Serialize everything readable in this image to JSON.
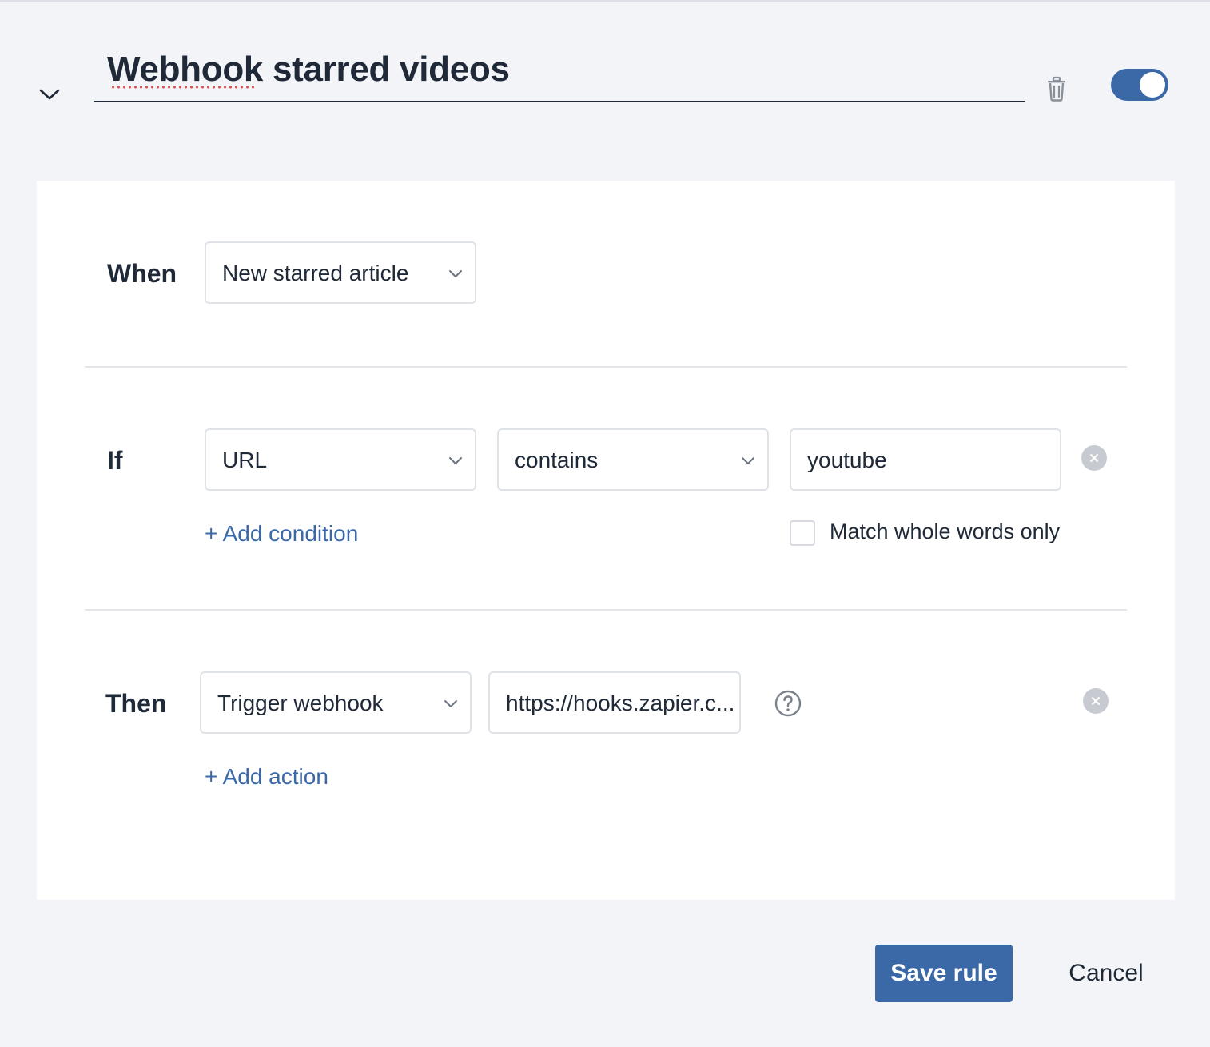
{
  "rule": {
    "title": "Webhook starred videos",
    "enabled": true
  },
  "when": {
    "label": "When",
    "trigger": "New starred article"
  },
  "if": {
    "label": "If",
    "field": "URL",
    "operator": "contains",
    "value": "youtube",
    "add_condition": "+ Add condition",
    "match_whole_words_label": "Match whole words only",
    "match_whole_words_checked": false
  },
  "then": {
    "label": "Then",
    "action": "Trigger webhook",
    "webhook_url": "https://hooks.zapier.c...",
    "add_action": "+ Add action"
  },
  "footer": {
    "save_label": "Save rule",
    "cancel_label": "Cancel"
  },
  "icons": {
    "collapse": "chevron-down-icon",
    "delete": "trash-icon",
    "dropdown": "chevron-down-icon",
    "remove": "close-circle-icon",
    "help": "help-circle-icon"
  },
  "colors": {
    "accent": "#3b69a8",
    "background": "#f2f4f8",
    "card": "#ffffff",
    "text": "#1f2937"
  }
}
